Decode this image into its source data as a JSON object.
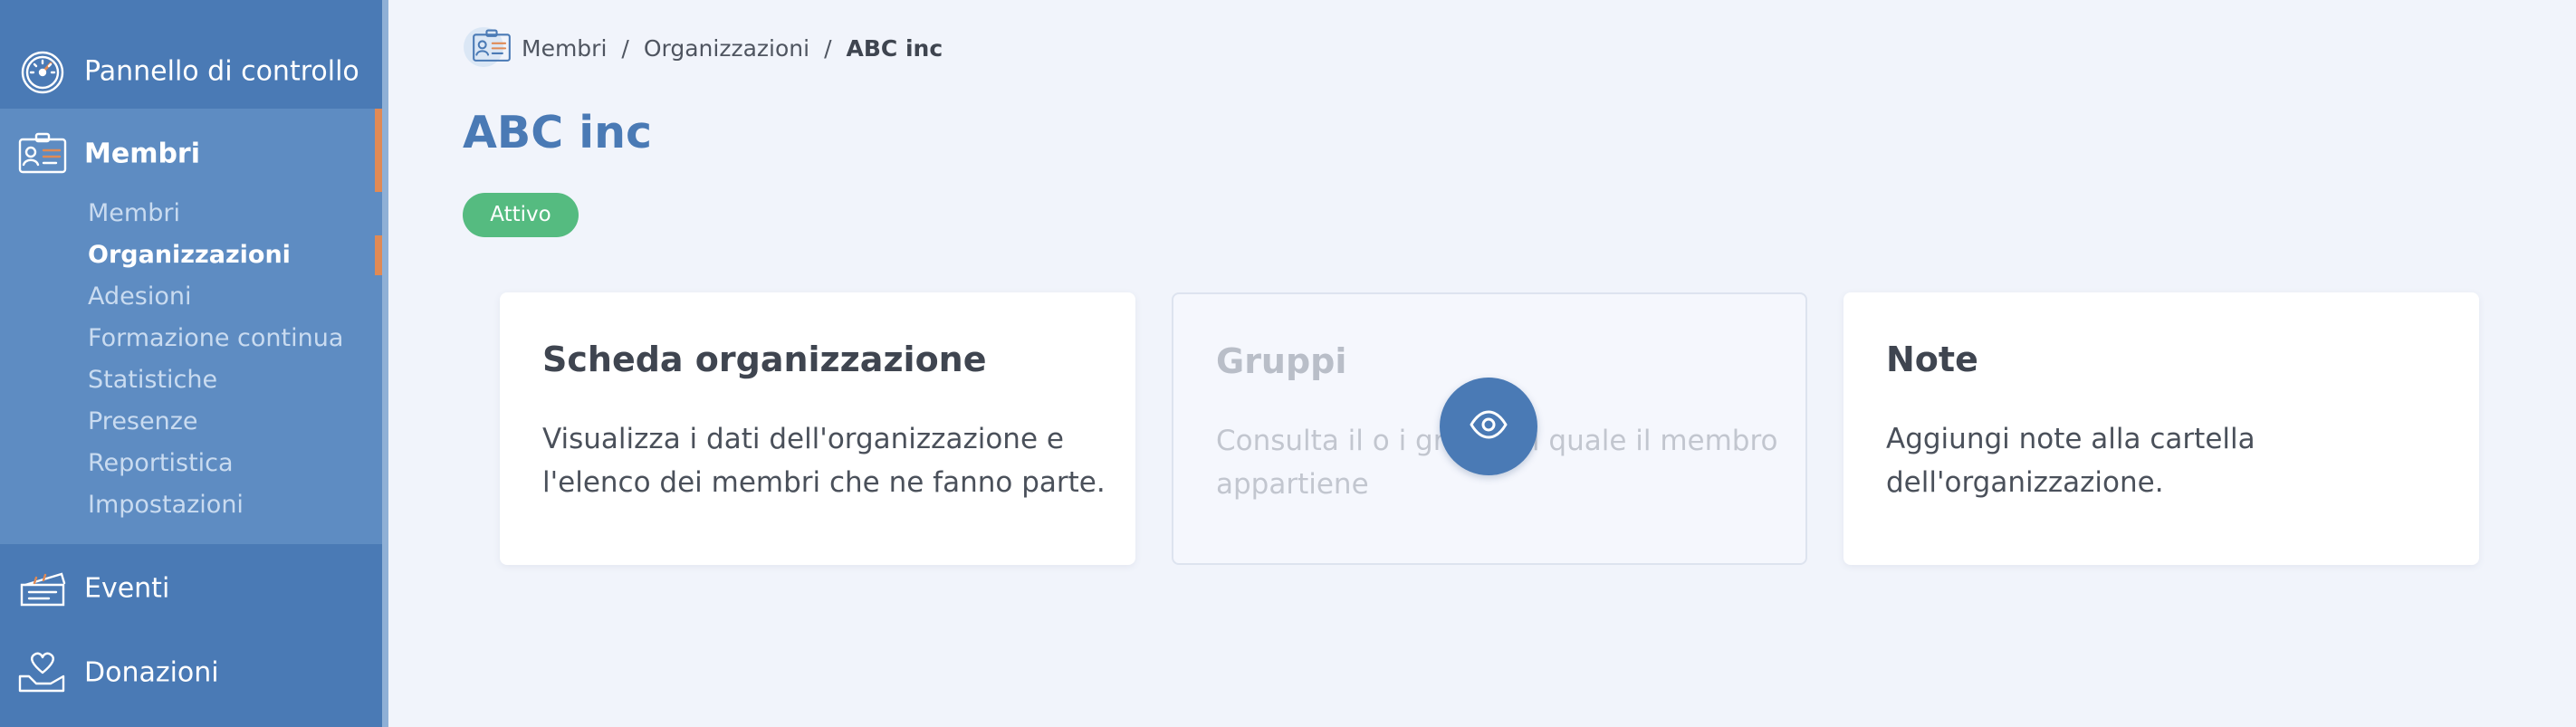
{
  "sidebar": {
    "items": [
      {
        "label": "Pannello di controllo",
        "icon": "dashboard-gauge-icon"
      },
      {
        "label": "Membri",
        "icon": "member-card-icon"
      },
      {
        "label": "Eventi",
        "icon": "tickets-icon"
      },
      {
        "label": "Donazioni",
        "icon": "heart-hand-icon"
      }
    ],
    "submenu": [
      {
        "label": "Membri"
      },
      {
        "label": "Organizzazioni"
      },
      {
        "label": "Adesioni"
      },
      {
        "label": "Formazione continua"
      },
      {
        "label": "Statistiche"
      },
      {
        "label": "Presenze"
      },
      {
        "label": "Reportistica"
      },
      {
        "label": "Impostazioni"
      }
    ],
    "active_item": "Membri",
    "active_subitem": "Organizzazioni"
  },
  "breadcrumb": {
    "icon": "member-card-icon",
    "items": [
      "Membri",
      "Organizzazioni",
      "ABC inc"
    ],
    "separator": "/"
  },
  "page": {
    "title": "ABC inc",
    "status": "Attivo"
  },
  "cards": [
    {
      "title": "Scheda organizzazione",
      "description": "Visualizza i dati dell'organizzazione e l'elenco dei membri che ne fanno parte."
    },
    {
      "title": "Gruppi",
      "description": "Consulta il o i gruppi al quale il membro appartiene"
    },
    {
      "title": "Note",
      "description": "Aggiungi note alla cartella dell'organizzazione."
    }
  ],
  "overlay": {
    "icon": "eye-icon"
  },
  "colors": {
    "sidebar": "#4a7ab5",
    "sidebar_group": "#5e8cc2",
    "accent": "#e08a55",
    "title": "#4a7ab5",
    "status_active": "#55bb80",
    "background": "#f1f4fb"
  }
}
